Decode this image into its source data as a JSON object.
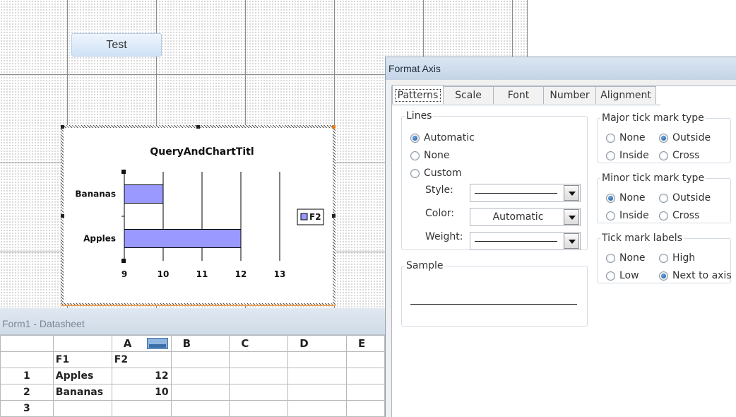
{
  "design": {
    "test_button_label": "Test"
  },
  "chart_data": {
    "type": "bar",
    "orientation": "horizontal",
    "title": "QueryAndChartTitl",
    "categories": [
      "Apples",
      "Bananas"
    ],
    "series": [
      {
        "name": "F2",
        "values": [
          12,
          10
        ],
        "color": "#9999ff"
      }
    ],
    "xlim": [
      9,
      13
    ],
    "xticks": [
      "9",
      "10",
      "11",
      "12",
      "13"
    ],
    "legend": "right",
    "grid": true
  },
  "datasheet": {
    "title": "Form1 - Datasheet",
    "columns": [
      "A",
      "B",
      "C",
      "D",
      "E"
    ],
    "header_row": {
      "f1": "F1",
      "f2": "F2"
    },
    "rows": [
      {
        "num": "1",
        "f1": "Apples",
        "f2": "12"
      },
      {
        "num": "2",
        "f1": "Bananas",
        "f2": "10"
      },
      {
        "num": "3",
        "f1": "",
        "f2": ""
      }
    ]
  },
  "dialog": {
    "title": "Format Axis",
    "tabs": [
      "Patterns",
      "Scale",
      "Font",
      "Number",
      "Alignment"
    ],
    "active_tab": "Patterns",
    "lines": {
      "legend": "Lines",
      "automatic": "Automatic",
      "none": "None",
      "custom": "Custom",
      "style_label": "Style:",
      "color_label": "Color:",
      "color_value": "Automatic",
      "weight_label": "Weight:"
    },
    "sample": {
      "legend": "Sample"
    },
    "major_tick": {
      "legend": "Major tick mark type",
      "none": "None",
      "outside": "Outside",
      "inside": "Inside",
      "cross": "Cross"
    },
    "minor_tick": {
      "legend": "Minor tick mark type",
      "none": "None",
      "outside": "Outside",
      "inside": "Inside",
      "cross": "Cross"
    },
    "tick_labels": {
      "legend": "Tick mark labels",
      "none": "None",
      "high": "High",
      "low": "Low",
      "next_to_axis": "Next to axis"
    }
  },
  "colors": {
    "accent": "#1c4f8c",
    "bar": "#9999ff",
    "titlebar": "#c4d4e6"
  }
}
